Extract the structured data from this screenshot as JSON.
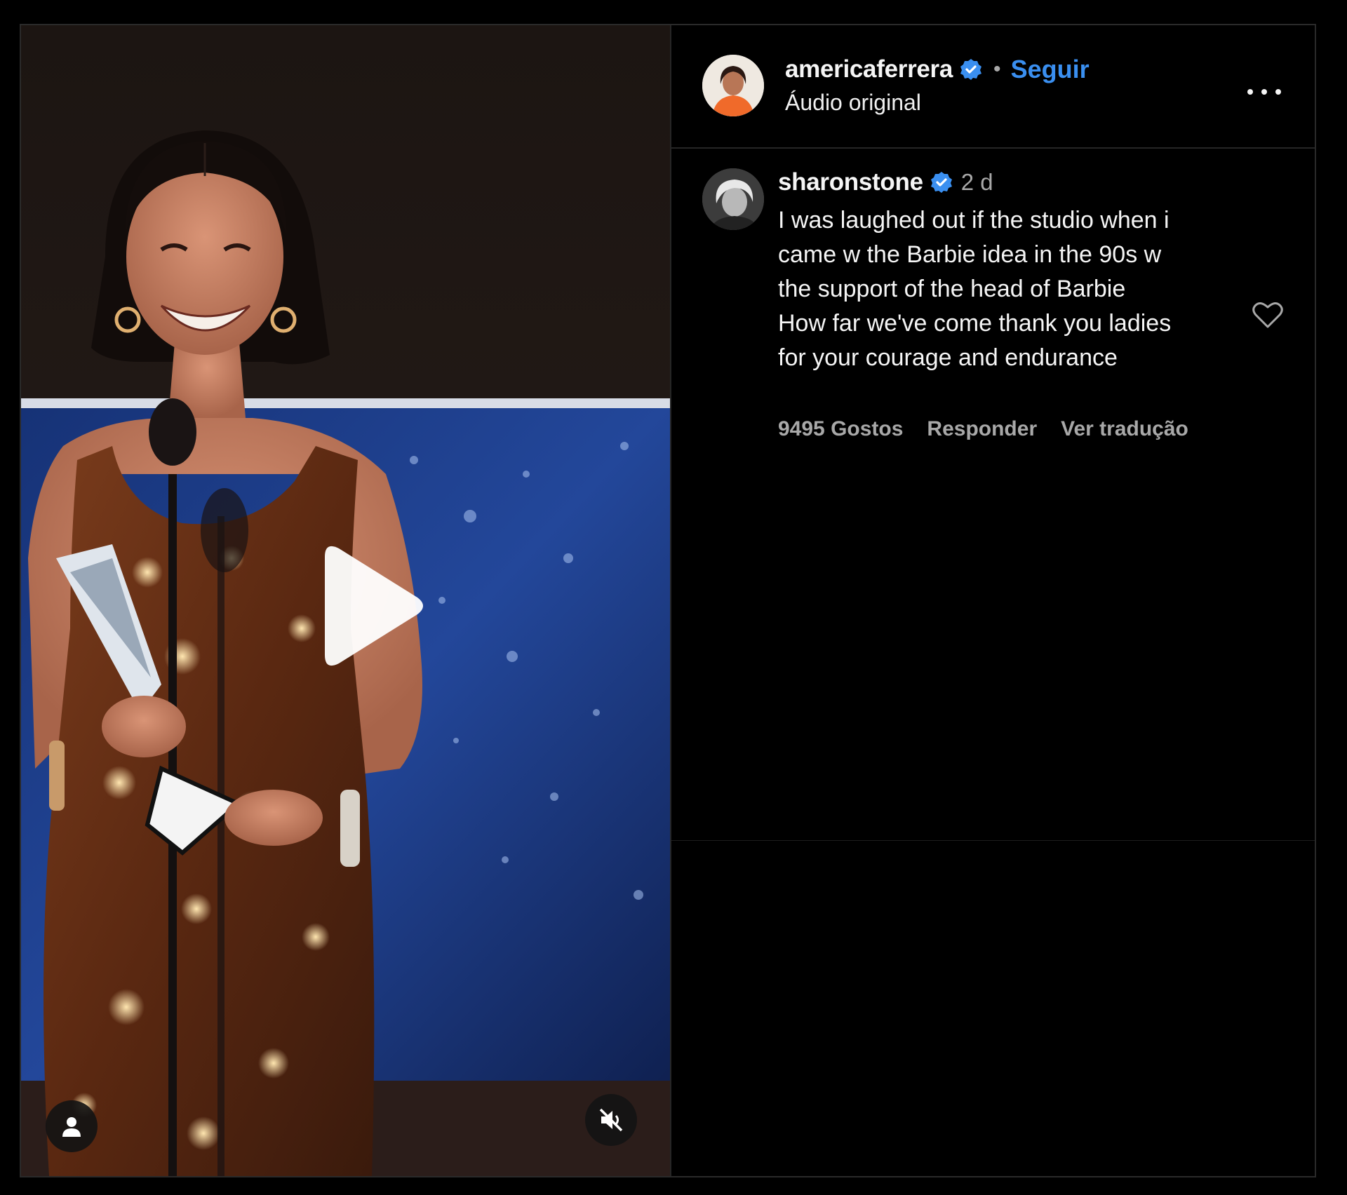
{
  "post": {
    "author": {
      "username": "americaferrera",
      "verified_icon": "verified-badge-icon",
      "separator": "•",
      "follow_label": "Seguir",
      "audio_label": "Áudio original"
    },
    "more_icon": "more-options-icon"
  },
  "comment": {
    "username": "sharonstone",
    "time": "2 d",
    "text": "I was laughed out if the studio when i\ncame w the Barbie idea in the 90s w\nthe support of the head of Barbie\nHow far we've come thank you ladies\nfor your courage and endurance",
    "likes_label": "9495 Gostos",
    "reply_label": "Responder",
    "translate_label": "Ver tradução",
    "like_icon": "heart-outline-icon"
  },
  "video": {
    "play_icon": "play-icon",
    "tags_icon": "user-tag-icon",
    "mute_icon": "speaker-muted-icon",
    "colors": {
      "stage_blue": "#1c3c8c",
      "backdrop": "#120c0a",
      "dress": "#6a3218",
      "skin": "#c98466"
    }
  },
  "colors": {
    "background": "#000000",
    "text": "#f5f5f5",
    "muted": "#a8a8a8",
    "link": "#3a8ff0",
    "divider": "#262626"
  }
}
